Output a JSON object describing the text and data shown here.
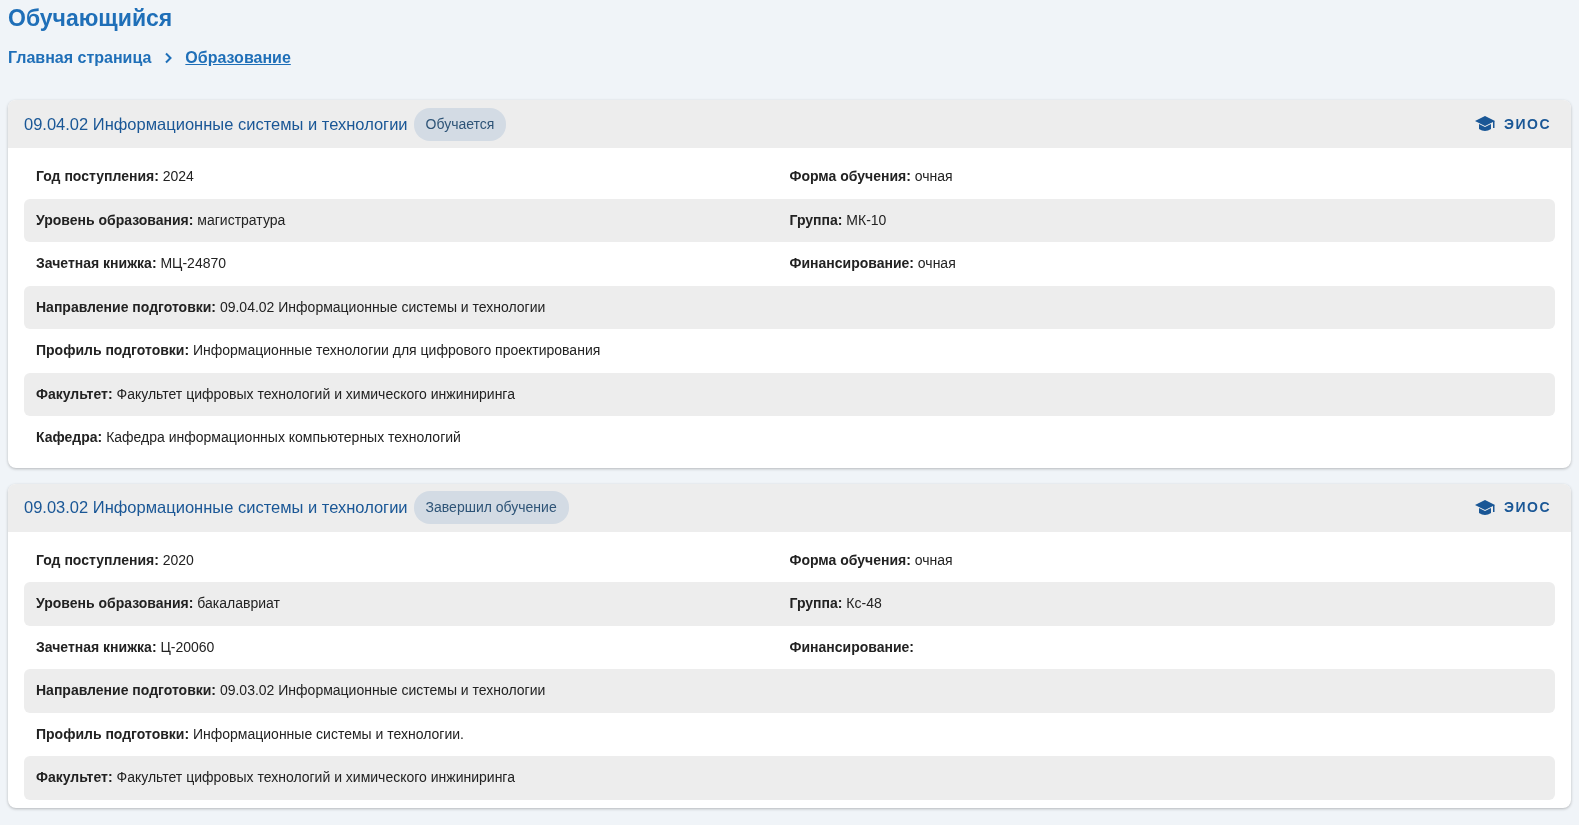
{
  "page_title": "Обучающийся",
  "breadcrumb": [
    {
      "label": "Главная страница",
      "current": false
    },
    {
      "label": "Образование",
      "current": true
    }
  ],
  "programs": [
    {
      "title": "09.04.02 Информационные системы и технологии",
      "status": "Обучается",
      "link": "ЭИОС",
      "rows": [
        [
          {
            "label": "Год поступления:",
            "value": "2024"
          },
          {
            "label": "Форма обучения:",
            "value": "очная"
          }
        ],
        [
          {
            "label": "Уровень образования:",
            "value": "магистратура"
          },
          {
            "label": "Группа:",
            "value": "МК-10"
          }
        ],
        [
          {
            "label": "Зачетная книжка:",
            "value": "МЦ-24870"
          },
          {
            "label": "Финансирование:",
            "value": "очная"
          }
        ],
        [
          {
            "label": "Направление подготовки:",
            "value": "09.04.02 Информационные системы и технологии"
          }
        ],
        [
          {
            "label": "Профиль подготовки:",
            "value": "Информационные технологии для цифрового проектирования"
          }
        ],
        [
          {
            "label": "Факультет:",
            "value": "Факультет цифровых технологий и химического инжиниринга"
          }
        ],
        [
          {
            "label": "Кафедра:",
            "value": "Кафедра информационных компьютерных технологий"
          }
        ]
      ]
    },
    {
      "title": "09.03.02 Информационные системы и технологии",
      "status": "Завершил обучение",
      "link": "ЭИОС",
      "rows": [
        [
          {
            "label": "Год поступления:",
            "value": "2020"
          },
          {
            "label": "Форма обучения:",
            "value": "очная"
          }
        ],
        [
          {
            "label": "Уровень образования:",
            "value": "бакалавриат"
          },
          {
            "label": "Группа:",
            "value": "Кс-48"
          }
        ],
        [
          {
            "label": "Зачетная книжка:",
            "value": "Ц-20060"
          },
          {
            "label": "Финансирование:"
          }
        ],
        [
          {
            "label": "Направление подготовки:",
            "value": "09.03.02 Информационные системы и технологии"
          }
        ],
        [
          {
            "label": "Профиль подготовки:",
            "value": "Информационные системы и технологии."
          }
        ],
        [
          {
            "label": "Факультет:",
            "value": "Факультет цифровых технологий и химического инжиниринга"
          }
        ]
      ]
    }
  ]
}
